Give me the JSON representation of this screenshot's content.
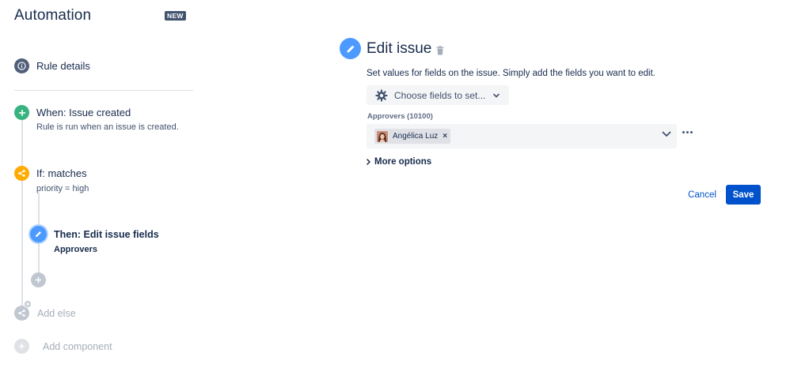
{
  "app": {
    "title": "Automation",
    "badge": "NEW"
  },
  "rule_details": {
    "label": "Rule details",
    "icon": "info-icon"
  },
  "components": {
    "trigger": {
      "title": "When: Issue created",
      "description": "Rule is run when an issue is created.",
      "icon": "plus-icon",
      "color": "#36B37E"
    },
    "condition": {
      "title": "If: matches",
      "description": "priority = high",
      "icon": "branch-icon",
      "color": "#FFAB00"
    },
    "action": {
      "title": "Then: Edit issue fields",
      "description": "Approvers",
      "icon": "pencil-icon",
      "color": "#4C9AFF"
    },
    "add_else": {
      "label": "Add else"
    },
    "add_component": {
      "label": "Add component"
    }
  },
  "panel": {
    "title": "Edit issue",
    "description": "Set values for fields on the issue. Simply add the fields you want to edit.",
    "choose_fields": {
      "label": "Choose fields to set..."
    },
    "field": {
      "label": "Approvers (10100)",
      "chips": [
        {
          "name": "Angélica Luz"
        }
      ],
      "remove_glyph": "×"
    },
    "more_options": {
      "label": "More options"
    },
    "cancel": {
      "label": "Cancel"
    },
    "save": {
      "label": "Save"
    }
  },
  "colors": {
    "primary": "#0052CC",
    "text": "#172B4D",
    "muted": "#A5ADBA"
  }
}
